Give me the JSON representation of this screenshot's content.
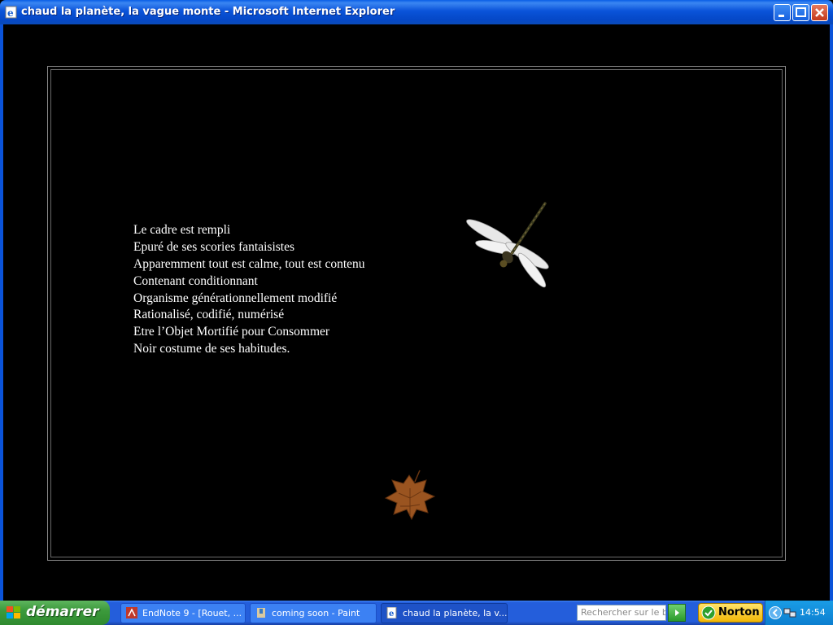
{
  "window": {
    "title": "chaud la planète, la vague monte - Microsoft Internet Explorer",
    "controls": [
      "minimize",
      "maximize",
      "close"
    ]
  },
  "poem": {
    "lines": [
      "Le cadre est rempli",
      "Epuré de ses scories fantaisistes",
      "Apparemment tout est calme, tout est contenu",
      "Contenant conditionnant",
      "Organisme générationnellement modifié",
      "Rationalisé, codifié, numérisé",
      "Etre l’Objet Mortifié pour Consommer",
      "Noir costume de ses habitudes."
    ]
  },
  "images": {
    "dragonfly": "dragonfly-image",
    "leaf": "autumn-leaf-image"
  },
  "taskbar": {
    "start_label": "démarrer",
    "tasks": [
      {
        "label": "EndNote 9 - [Rouet, ...",
        "icon": "endnote-icon"
      },
      {
        "label": "coming soon - Paint",
        "icon": "paint-icon"
      },
      {
        "label": "chaud la planète, la v...",
        "icon": "ie-icon",
        "active": true
      }
    ],
    "search_placeholder": "Rechercher sur le bur",
    "norton_label": "Norton",
    "clock": "14:54"
  },
  "colors": {
    "titlebar": "#0a53d9",
    "taskbar": "#245edb",
    "start": "#3c9a3c",
    "page_background": "#000000",
    "poem_text": "#ffffff"
  }
}
